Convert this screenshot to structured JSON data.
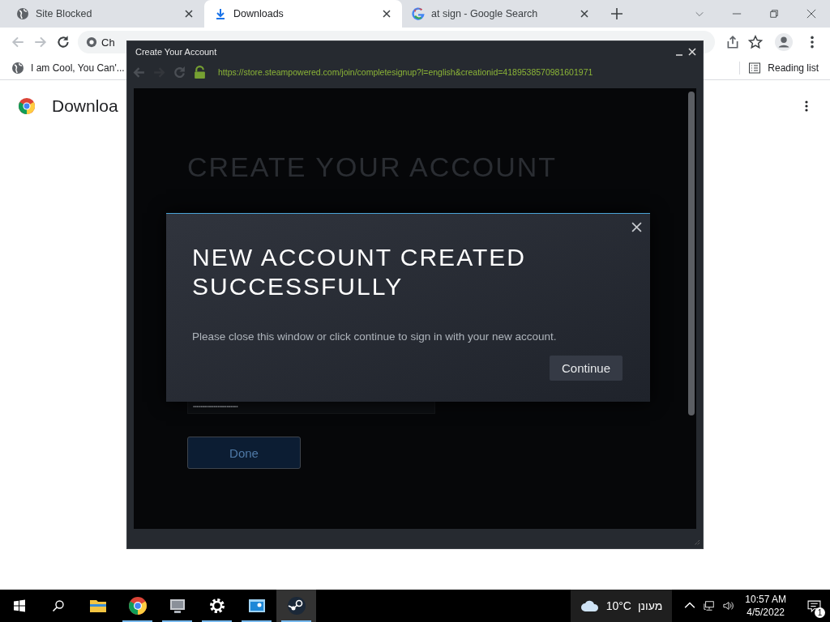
{
  "browser": {
    "tabs": [
      {
        "kind": "globe",
        "title": "Site Blocked",
        "selected": false
      },
      {
        "kind": "download",
        "title": "Downloads",
        "selected": true
      },
      {
        "kind": "google",
        "title": "at sign - Google Search",
        "selected": false
      }
    ],
    "address": {
      "value": "Ch"
    },
    "bookmarks": [
      {
        "title": "I am Cool, You Can'..."
      }
    ],
    "reading_list": "Reading list",
    "page": {
      "heading": "Downloa"
    }
  },
  "popup": {
    "title": "Create Your Account",
    "url": "https://store.steampowered.com/join/completesignup?l=english&creationid=4189538570981601971",
    "page": {
      "heading": "CREATE YOUR ACCOUNT",
      "password": "••••••••••••••••••••••••",
      "button": "Done"
    },
    "dialog": {
      "title": "NEW ACCOUNT CREATED SUCCESSFULLY",
      "message": "Please close this window or click continue to sign in with your new account.",
      "button": "Continue"
    }
  },
  "taskbar": {
    "apps": [
      {
        "kind": "explorer",
        "running": false,
        "selected": false
      },
      {
        "kind": "chrome",
        "running": true,
        "selected": false
      },
      {
        "kind": "monitor",
        "running": true,
        "selected": false
      },
      {
        "kind": "settings",
        "running": true,
        "selected": false
      },
      {
        "kind": "panel",
        "running": true,
        "selected": false
      },
      {
        "kind": "steam",
        "running": true,
        "selected": true
      }
    ],
    "weather": {
      "temperature": "10°C",
      "condition": "מעונן"
    },
    "time": "10:57 AM",
    "date": "4/5/2022",
    "notifications": "1"
  }
}
